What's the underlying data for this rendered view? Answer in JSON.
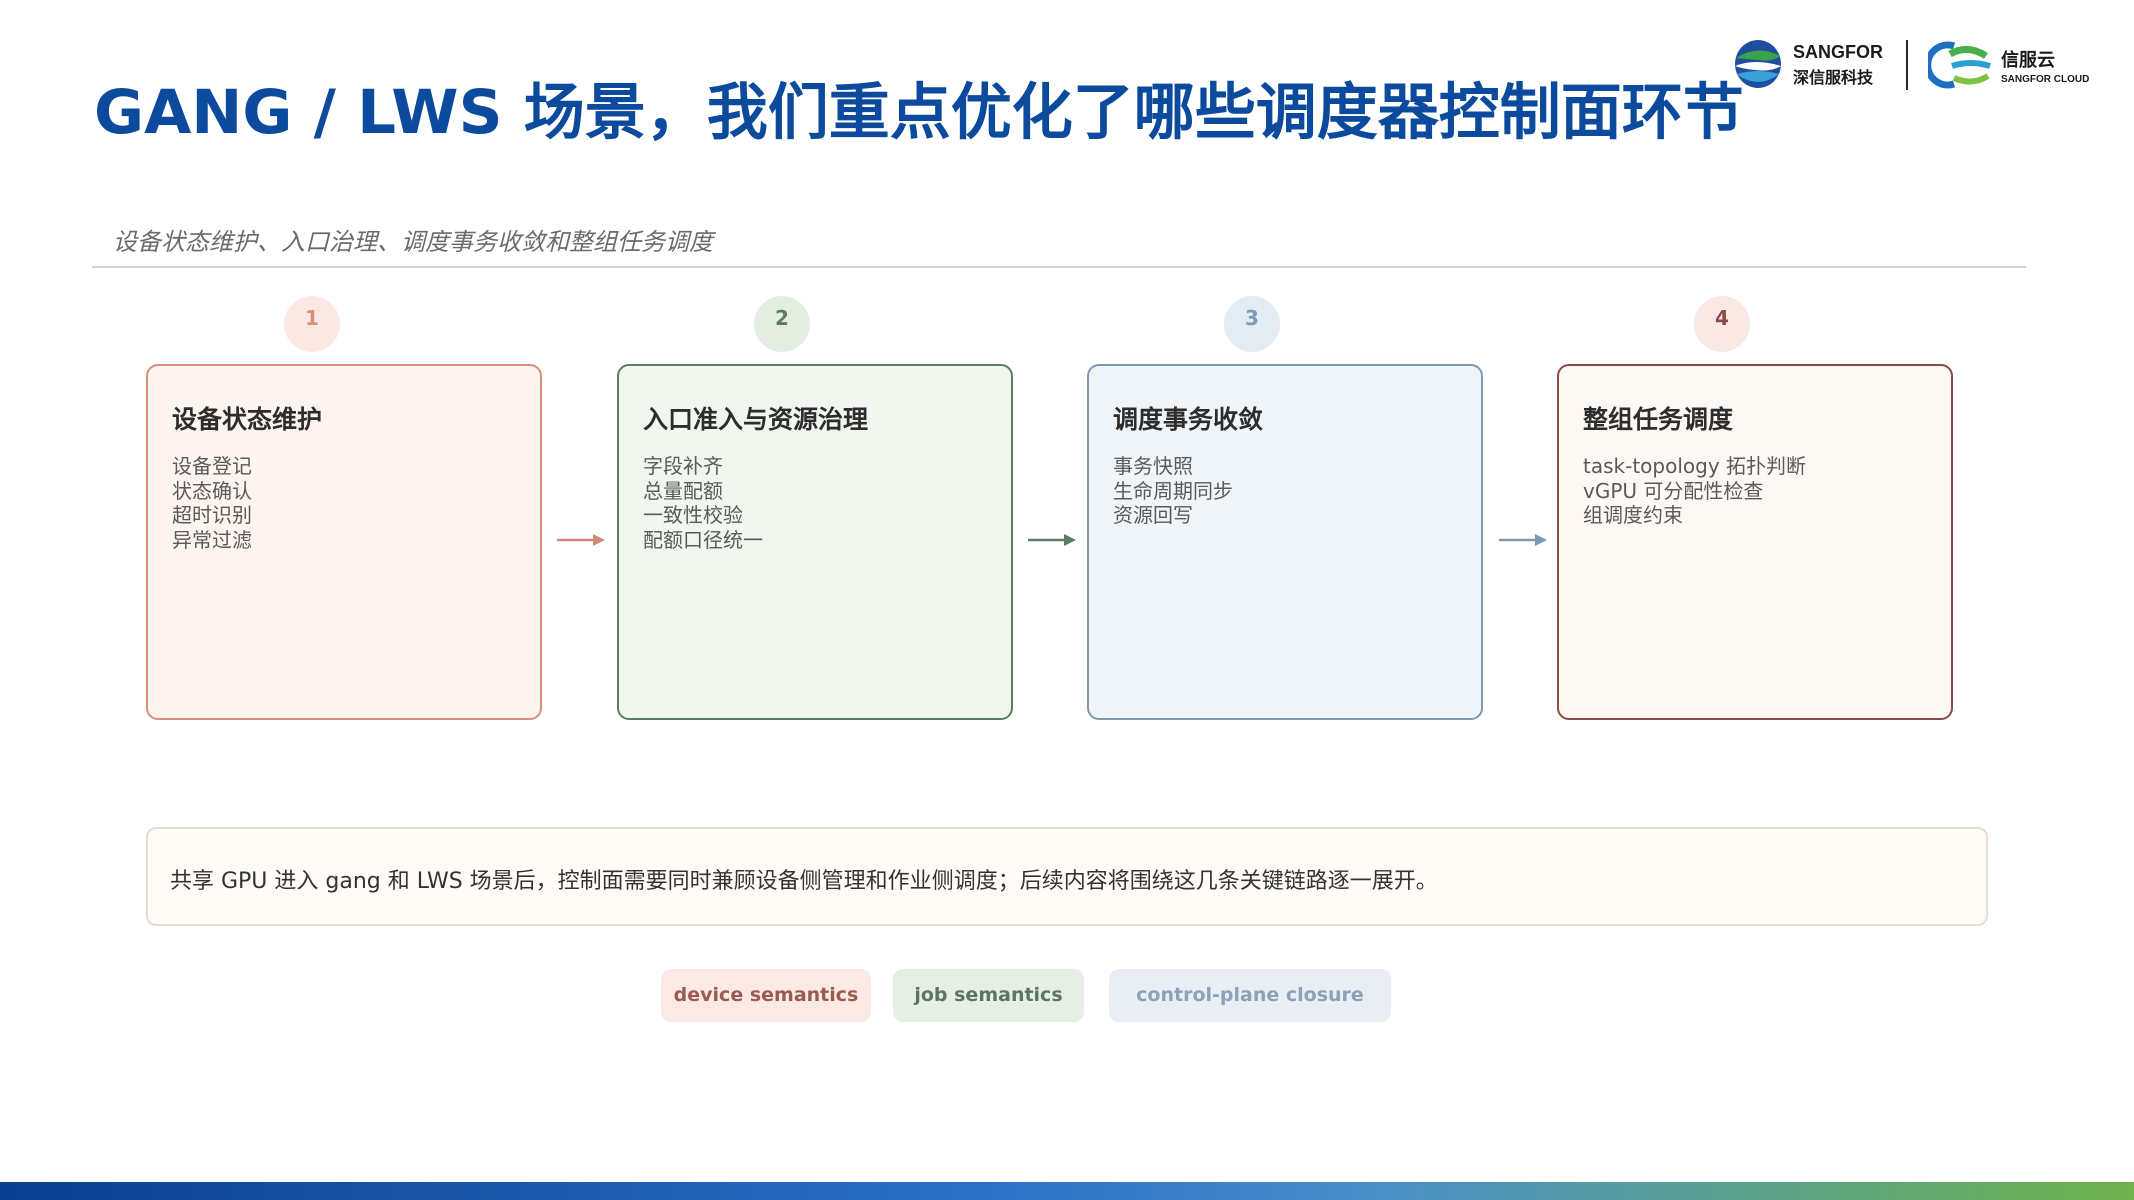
{
  "title": "GANG / LWS 场景，我们重点优化了哪些调度器控制面环节",
  "logos": {
    "sangfor_en": "SANGFOR",
    "sangfor_cn": "深信服科技",
    "cloud_cn": "信服云",
    "cloud_en": "SANGFOR CLOUD"
  },
  "subtitle": "设备状态维护、入口治理、调度事务收敛和整组任务调度",
  "steps": [
    {
      "number": "1",
      "title": "设备状态维护",
      "items": [
        "设备登记",
        "状态确认",
        "超时识别",
        "异常过滤"
      ],
      "accent": "#d68d7a",
      "fill": "#fdf3ef",
      "badge": "#fbe8e2"
    },
    {
      "number": "2",
      "title": "入口准入与资源治理",
      "items": [
        "字段补齐",
        "总量配额",
        "一致性校验",
        "配额口径统一"
      ],
      "accent": "#5c7c63",
      "fill": "#f1f7ef",
      "badge": "#e3eee1"
    },
    {
      "number": "3",
      "title": "调度事务收敛",
      "items": [
        "事务快照",
        "生命周期同步",
        "资源回写"
      ],
      "accent": "#7d9ab3",
      "fill": "#f0f5fa",
      "badge": "#e4ecf3"
    },
    {
      "number": "4",
      "title": "整组任务调度",
      "items": [
        "task-topology 拓扑判断",
        "vGPU 可分配性检查",
        "组调度约束"
      ],
      "accent": "#8a4a47",
      "fill": "#fdf8f3",
      "badge": "#f9e8e4"
    }
  ],
  "summary": "共享 GPU 进入 gang 和 LWS 场景后，控制面需要同时兼顾设备侧管理和作业侧调度；后续内容将围绕这几条关键链路逐一展开。",
  "tags": [
    {
      "label": "device semantics",
      "color": "#9a5a50",
      "bg": "#fbe9e4"
    },
    {
      "label": "job semantics",
      "color": "#5d7560",
      "bg": "#e5efe3"
    },
    {
      "label": "control-plane closure",
      "color": "#8aa2b8",
      "bg": "#e8eef4"
    }
  ]
}
